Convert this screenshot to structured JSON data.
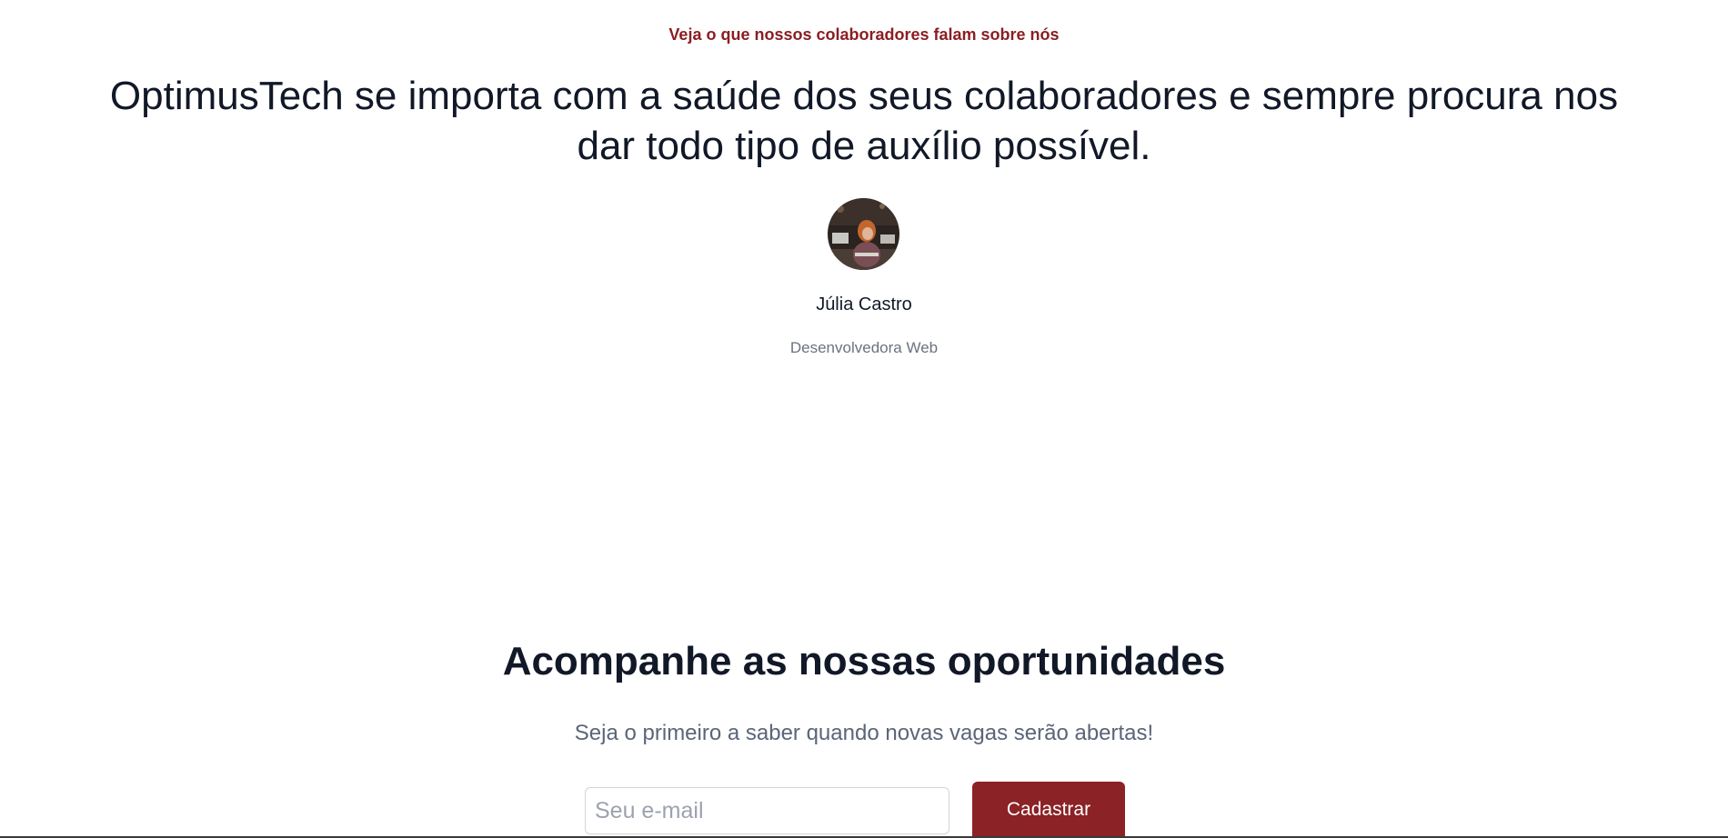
{
  "testimonial": {
    "eyebrow": "Veja o que nossos colaboradores falam sobre nós",
    "quote": "OptimusTech se importa com a saúde dos seus colaboradores e sempre procura nos dar todo tipo de auxílio possível.",
    "person_name": "Júlia Castro",
    "person_role": "Desenvolvedora Web"
  },
  "newsletter": {
    "title": "Acompanhe as nossas oportunidades",
    "subtitle": "Seja o primeiro a saber quando novas vagas serão abertas!",
    "email_placeholder": "Seu e-mail",
    "submit_label": "Cadastrar"
  },
  "colors": {
    "accent": "#8b2225",
    "heading": "#111827",
    "muted": "#6b7280"
  }
}
